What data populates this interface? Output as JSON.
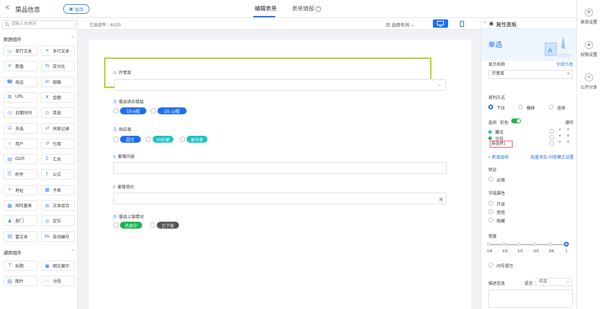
{
  "header": {
    "back": "<",
    "title": "菜品信息",
    "save_label": "保存",
    "tabs": [
      "编辑表单",
      "表单填报"
    ],
    "help_glyph": "?"
  },
  "left": {
    "search_placeholder": "请输入关键词",
    "section1": "数据组件",
    "components1": [
      "单行文本",
      "多行文本",
      "数值",
      "百分比",
      "电话",
      "邮箱",
      "URL",
      "金额",
      "日期时间",
      "单选",
      "多选",
      "关联记录",
      "用户",
      "引用",
      "OCR",
      "汇总",
      "附件",
      "公式",
      "地址",
      "子表",
      "矩阵量表",
      "文本组合",
      "部门",
      "定位",
      "富文本",
      "自动编号"
    ],
    "section2": "通用组件",
    "components2": [
      "标题",
      "图文展示",
      "图片",
      "分段"
    ]
  },
  "canvas": {
    "count": "已选组件：6/120",
    "layout": "选择布局",
    "fields": {
      "f1": "开胃菜",
      "f2": "餐品供应楼层",
      "f2_opts": [
        "D5-6楼",
        "D5-13楼"
      ],
      "f3": "供应商",
      "f3_opts": [
        "厨王",
        "V5乐屋",
        "家乐家"
      ],
      "f4": "套餐内容",
      "f5": "套餐单价",
      "f5_unit": "元",
      "f6": "餐品上架情况",
      "f6_opts": [
        "热卖中",
        "已下架"
      ]
    }
  },
  "right": {
    "title": "属性面板",
    "hero": "单选",
    "display_name_label": "显示名称",
    "field_ref": "字段引用",
    "display_name_value": "开胃菜",
    "arrangement_label": "排列方式",
    "arrangement": [
      "下拉",
      "横排",
      "竖排"
    ],
    "options_label": "选项",
    "colors_label": "彩色",
    "ops_label": "操作",
    "options": [
      "雕冻",
      "沙拉",
      "新选项1"
    ],
    "add_option": "+ 新增选项",
    "batch_add": "批量添加",
    "q_mode": "问卷模式设置",
    "validation": "验证",
    "required": "必填",
    "field_attr": "字段属性",
    "attrs": [
      "只读",
      "禁用",
      "隐藏"
    ],
    "width_label": "宽度",
    "width_ticks": [
      "1/4",
      "1/3",
      "1/2",
      "2/3",
      "3/4",
      "1"
    ],
    "hint": "问号提示",
    "desc_label": "描述信息",
    "lang_label": "语言:",
    "lang_value": "中文"
  },
  "tools": [
    "表单设置",
    "权限设置",
    "公开分享"
  ],
  "colors": {
    "accent": "#1e6ff1",
    "highlight": "#a6d52e",
    "green": "#1ab34a",
    "teal": "#19c4c4",
    "dark": "#555555"
  }
}
